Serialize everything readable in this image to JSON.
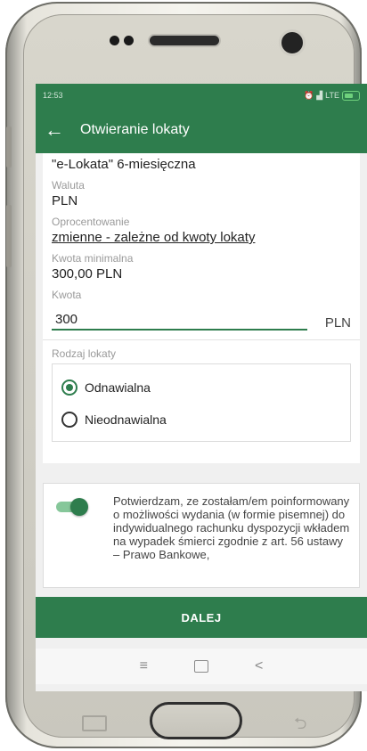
{
  "status_bar": {
    "time": "12:53",
    "right": "LTE"
  },
  "app_bar": {
    "back": "←",
    "title": "Otwieranie lokaty"
  },
  "form": {
    "product_name": "\"e-Lokata\" 6-miesięczna",
    "currency_label": "Waluta",
    "currency_value": "PLN",
    "interest_label": "Oprocentowanie",
    "interest_value": "zmienne - zależne od kwoty lokaty",
    "min_amount_label": "Kwota minimalna",
    "min_amount_value": "300,00 PLN",
    "amount_label": "Kwota",
    "amount_value": "300",
    "amount_unit": "PLN",
    "deposit_type_label": "Rodzaj lokaty",
    "options": [
      {
        "label": "Odnawialna",
        "selected": true
      },
      {
        "label": "Nieodnawialna",
        "selected": false
      }
    ]
  },
  "consent": {
    "toggle_on": true,
    "text": "Potwierdzam, ze zostałam/em poinformowany o możliwości wydania (w formie pisemnej) do indywidualnego rachunku dyspozycji wkładem na wypadek śmierci zgodnie z  art. 56 ustawy – Prawo Bankowe,"
  },
  "next_button": "DALEJ",
  "nav": {
    "recent": "≡",
    "back": "<"
  },
  "colors": {
    "primary": "#2e7d4d",
    "accent_light": "#86c79a"
  }
}
